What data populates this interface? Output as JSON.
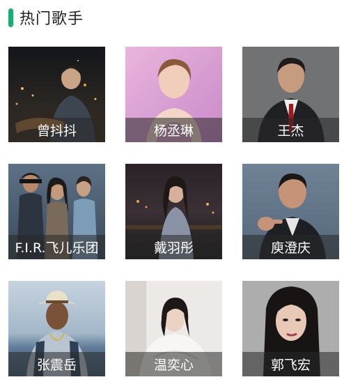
{
  "section": {
    "title": "热门歌手",
    "accent_color": "#1aad6b"
  },
  "singers": [
    {
      "name": "曾抖抖",
      "photo": "singer-photo-guitar-night-city"
    },
    {
      "name": "杨丞琳",
      "photo": "singer-photo-pink-backdrop"
    },
    {
      "name": "王杰",
      "photo": "singer-photo-suit-gray-backdrop"
    },
    {
      "name": "F.I.R.飞儿乐团",
      "photo": "singer-photo-band-trio"
    },
    {
      "name": "戴羽彤",
      "photo": "singer-photo-night-street"
    },
    {
      "name": "庾澄庆",
      "photo": "singer-photo-pointing-gray-backdrop"
    },
    {
      "name": "张震岳",
      "photo": "singer-photo-hat-seaside"
    },
    {
      "name": "温奕心",
      "photo": "singer-photo-white-blanket"
    },
    {
      "name": "郭飞宏",
      "photo": "singer-photo-closeup-gray"
    }
  ]
}
